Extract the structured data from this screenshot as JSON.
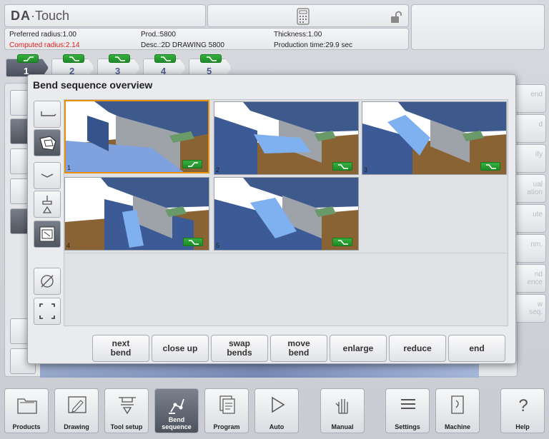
{
  "header": {
    "logo_brand": "DA",
    "logo_product": "Touch",
    "info": {
      "preferred_radius": "Preferred radius:1.00",
      "computed_radius": "Computed radius:2.14",
      "prod": "Prod.:5800",
      "desc": "Desc.:2D DRAWING 5800",
      "thickness": "Thickness:1.00",
      "production_time": "Production time:29.9 sec"
    },
    "icons": [
      "calculator-icon",
      "unlock-icon"
    ]
  },
  "bend_tabs": [
    {
      "number": "1",
      "active": true
    },
    {
      "number": "2",
      "active": false
    },
    {
      "number": "3",
      "active": false
    },
    {
      "number": "4",
      "active": false
    },
    {
      "number": "5",
      "active": false
    }
  ],
  "right_buttons_partial": [
    "end",
    "d",
    "ify",
    "ual\nation",
    "ute",
    "nm.",
    "nd\nence",
    "w\nseq."
  ],
  "dialog": {
    "title": "Bend sequence overview",
    "thumbnails": [
      {
        "number": "1",
        "selected": true
      },
      {
        "number": "2",
        "selected": false
      },
      {
        "number": "3",
        "selected": false
      },
      {
        "number": "4",
        "selected": false
      },
      {
        "number": "5",
        "selected": false
      }
    ],
    "actions": [
      {
        "id": "next-bend",
        "label": "next\nbend"
      },
      {
        "id": "close-up",
        "label": "close up"
      },
      {
        "id": "swap-bends",
        "label": "swap\nbends"
      },
      {
        "id": "move-bend",
        "label": "move\nbend"
      },
      {
        "id": "enlarge",
        "label": "enlarge"
      },
      {
        "id": "reduce",
        "label": "reduce"
      },
      {
        "id": "end",
        "label": "end"
      }
    ]
  },
  "bottom_nav": [
    {
      "id": "products",
      "label": "Products",
      "icon": "folder-icon"
    },
    {
      "id": "drawing",
      "label": "Drawing",
      "icon": "pencil-icon"
    },
    {
      "id": "tool-setup",
      "label": "Tool setup",
      "icon": "tool-icon"
    },
    {
      "id": "bend-sequence",
      "label": "Bend\nsequence",
      "icon": "robot-icon",
      "active": true
    },
    {
      "id": "program",
      "label": "Program",
      "icon": "pages-icon"
    },
    {
      "id": "auto",
      "label": "Auto",
      "icon": "play-icon"
    },
    {
      "id": "manual",
      "label": "Manual",
      "icon": "hand-icon"
    },
    {
      "id": "settings",
      "label": "Settings",
      "icon": "list-icon"
    },
    {
      "id": "machine",
      "label": "Machine",
      "icon": "machine-icon"
    },
    {
      "id": "help",
      "label": "Help",
      "icon": "question-icon"
    }
  ],
  "colors": {
    "accent_orange": "#e8920b",
    "bend_green": "#2a9d34",
    "warning_red": "#e0201c",
    "part_blue": "#6f95d8"
  }
}
